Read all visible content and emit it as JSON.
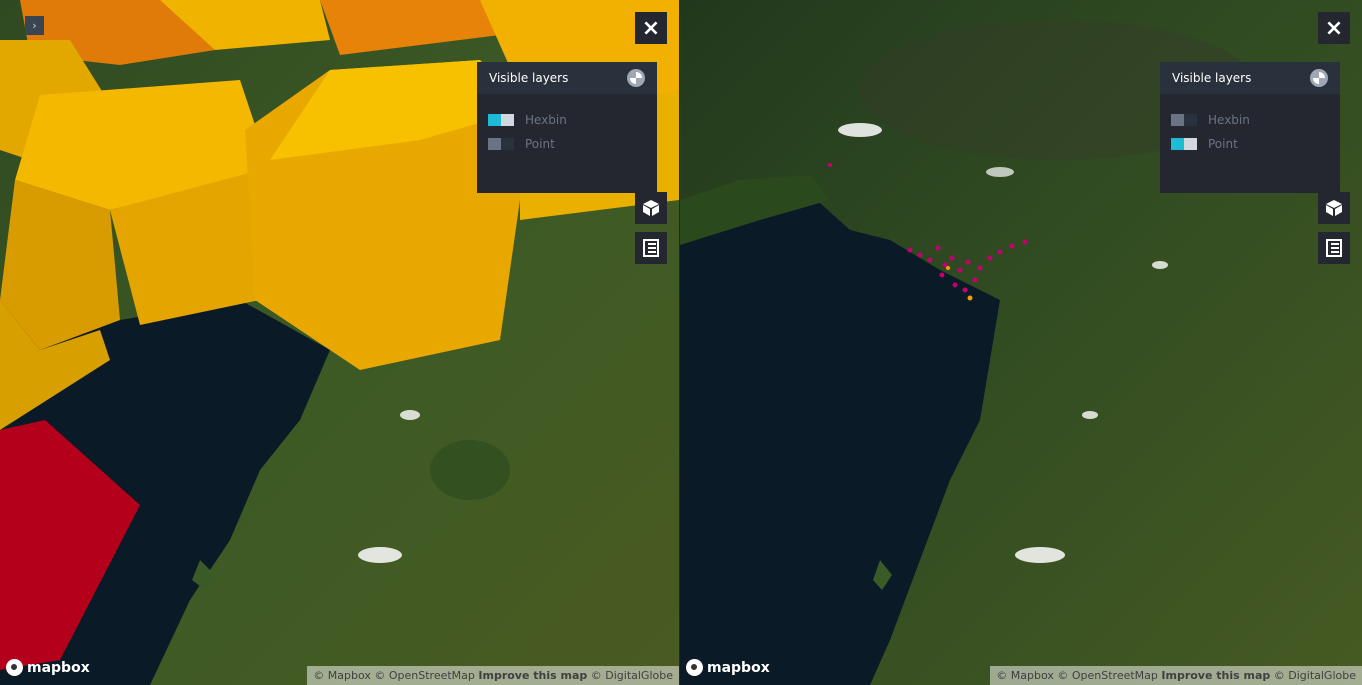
{
  "left_map": {
    "close_icon": "×",
    "expand_icon": "›",
    "panel": {
      "title": "Visible layers",
      "layers": [
        {
          "label": "Hexbin",
          "enabled": true
        },
        {
          "label": "Point",
          "enabled": false
        }
      ]
    },
    "logo_text": "mapbox",
    "attribution": {
      "mapbox": "© Mapbox",
      "osm": "© OpenStreetMap",
      "improve": "Improve this map",
      "dg": "© DigitalGlobe"
    }
  },
  "right_map": {
    "close_icon": "×",
    "panel": {
      "title": "Visible layers",
      "layers": [
        {
          "label": "Hexbin",
          "enabled": false
        },
        {
          "label": "Point",
          "enabled": true
        }
      ]
    },
    "logo_text": "mapbox",
    "attribution": {
      "mapbox": "© Mapbox",
      "osm": "© OpenStreetMap",
      "improve": "Improve this map",
      "dg": "© DigitalGlobe"
    }
  },
  "colors": {
    "panel_bg": "#242730",
    "toggle_on": "#1fbad6",
    "toggle_off": "#6a7485",
    "hex_yellow": "#f0b400",
    "hex_orange": "#e8830a",
    "hex_red": "#b5001c",
    "points": "#c4006e"
  }
}
